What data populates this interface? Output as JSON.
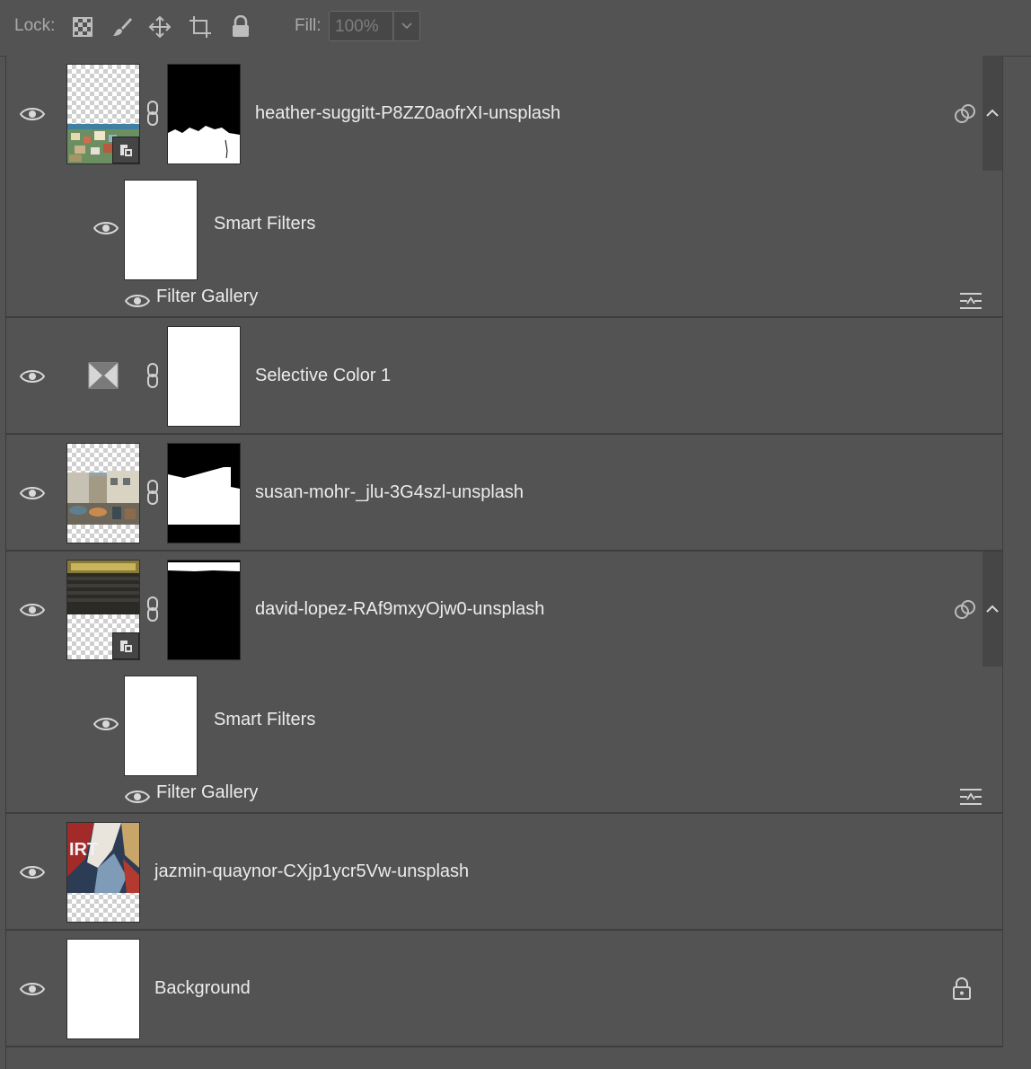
{
  "lockbar": {
    "lock_label": "Lock:",
    "fill_label": "Fill:",
    "fill_value": "100%",
    "icons": [
      "lock-transparent-pixels-icon",
      "lock-image-pixels-icon",
      "lock-position-icon",
      "lock-artboard-icon",
      "lock-all-icon"
    ]
  },
  "layers": [
    {
      "name": "heather-suggitt-P8ZZ0aofrXI-unsplash",
      "type": "smart-object",
      "smart_filters_label": "Smart Filters",
      "filter_label": "Filter Gallery"
    },
    {
      "name": "Selective Color 1",
      "type": "adjustment"
    },
    {
      "name": "susan-mohr-_jlu-3G4szl-unsplash",
      "type": "pixel-with-mask"
    },
    {
      "name": "david-lopez-RAf9mxyOjw0-unsplash",
      "type": "smart-object",
      "smart_filters_label": "Smart Filters",
      "filter_label": "Filter Gallery"
    },
    {
      "name": "jazmin-quaynor-CXjp1ycr5Vw-unsplash",
      "type": "pixel"
    },
    {
      "name": "Background",
      "type": "background",
      "locked": true
    }
  ],
  "colors": {
    "panel_bg": "#535353",
    "separator": "#3e3e3e",
    "text": "#ececec"
  }
}
